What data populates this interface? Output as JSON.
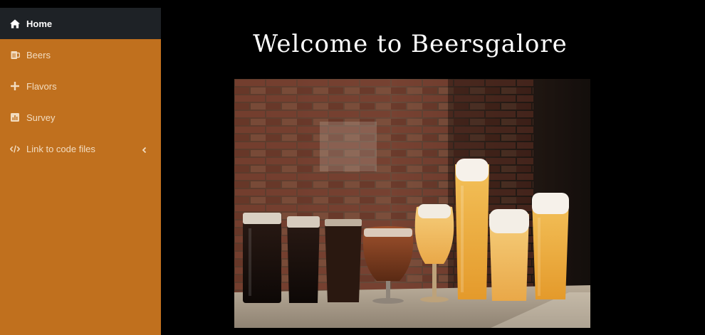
{
  "sidebar": {
    "items": [
      {
        "label": "Home",
        "icon": "home-icon",
        "active": true
      },
      {
        "label": "Beers",
        "icon": "beer-mug-icon",
        "active": false
      },
      {
        "label": "Flavors",
        "icon": "plus-icon",
        "active": false
      },
      {
        "label": "Survey",
        "icon": "bar-chart-icon",
        "active": false
      },
      {
        "label": "Link to code files",
        "icon": "code-icon",
        "active": false,
        "expandable": true
      }
    ],
    "colors": {
      "background": "#c0701e",
      "active_background": "#1e2226",
      "text": "#f2dcc0"
    }
  },
  "main": {
    "title": "Welcome to Beersgalore",
    "hero_image": {
      "icon": "beer-glasses-photo",
      "glass_count": 8
    }
  }
}
